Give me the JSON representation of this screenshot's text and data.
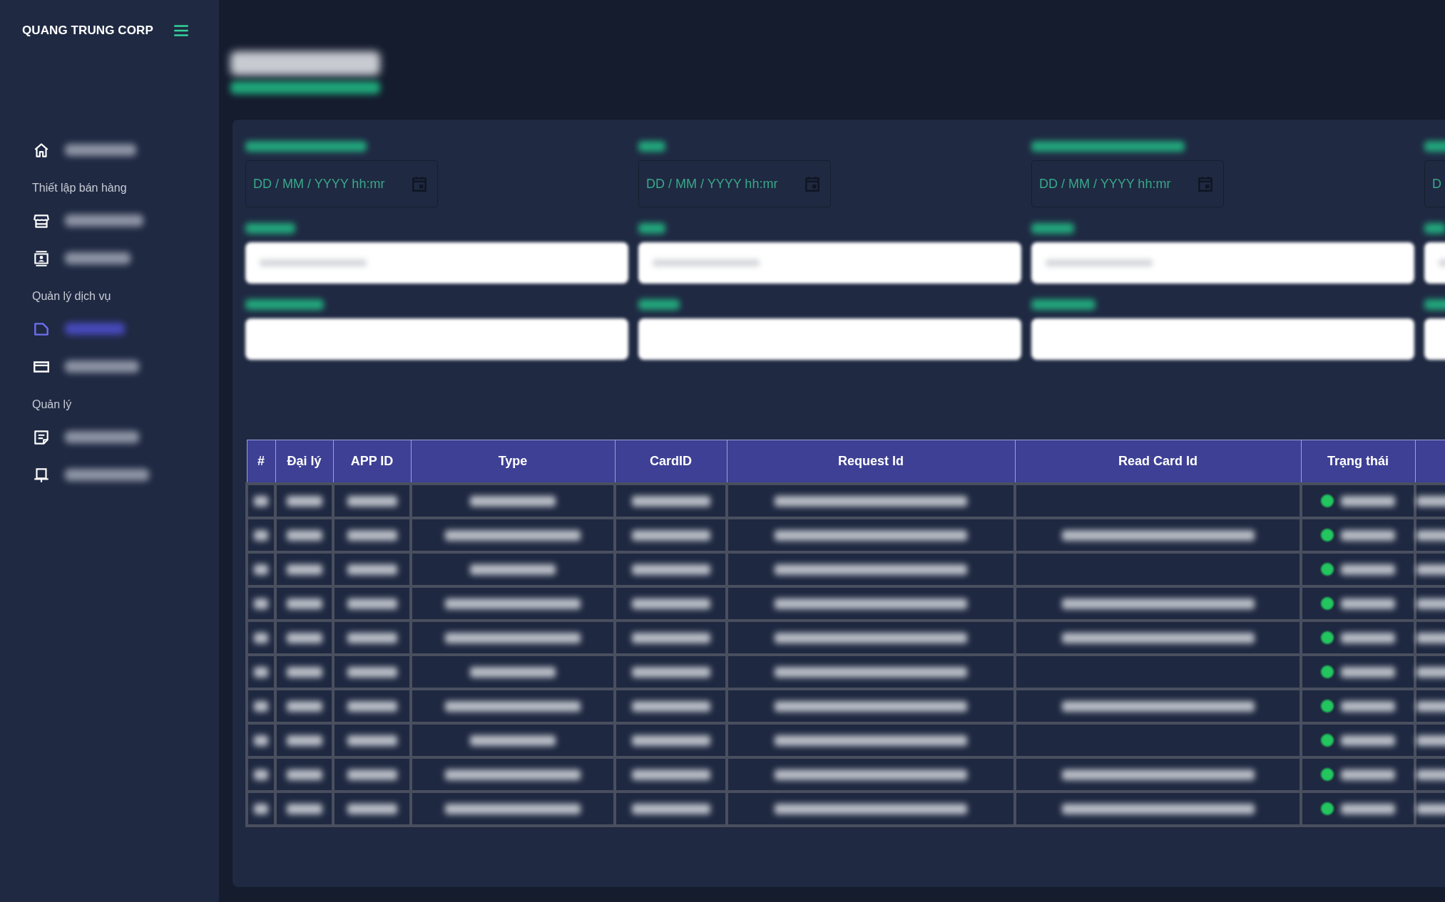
{
  "brand": {
    "name": "QUANG TRUNG CORP"
  },
  "sidebar": {
    "top_items": [
      {
        "selected": false
      }
    ],
    "sections": [
      {
        "title": "Thiết lập bán hàng",
        "items": [
          {
            "selected": false
          },
          {
            "selected": false
          }
        ]
      },
      {
        "title": "Quản lý dịch vụ",
        "items": [
          {
            "selected": true
          },
          {
            "selected": false
          }
        ]
      },
      {
        "title": "Quản lý",
        "items": [
          {
            "selected": false
          },
          {
            "selected": false
          }
        ]
      }
    ]
  },
  "filters": [
    {
      "kind": "date",
      "placeholder": "DD / MM / YYYY hh:mr"
    },
    {
      "kind": "date",
      "placeholder": "DD / MM / YYYY hh:mr"
    },
    {
      "kind": "date",
      "placeholder": "DD / MM / YYYY hh:mr"
    },
    {
      "kind": "date",
      "placeholder": "D"
    },
    {
      "kind": "select"
    },
    {
      "kind": "select"
    },
    {
      "kind": "select"
    },
    {
      "kind": "select"
    },
    {
      "kind": "text"
    },
    {
      "kind": "text"
    },
    {
      "kind": "text"
    },
    {
      "kind": "text"
    }
  ],
  "table": {
    "columns": [
      "#",
      "Đại lý",
      "APP ID",
      "Type",
      "CardID",
      "Request Id",
      "Read Card Id",
      "Trạng thái"
    ],
    "rows": [
      {
        "has_read_card_id": false
      },
      {
        "has_read_card_id": true
      },
      {
        "has_read_card_id": false
      },
      {
        "has_read_card_id": true
      },
      {
        "has_read_card_id": true
      },
      {
        "has_read_card_id": false
      },
      {
        "has_read_card_id": true
      },
      {
        "has_read_card_id": false
      },
      {
        "has_read_card_id": true
      },
      {
        "has_read_card_id": true
      }
    ]
  }
}
